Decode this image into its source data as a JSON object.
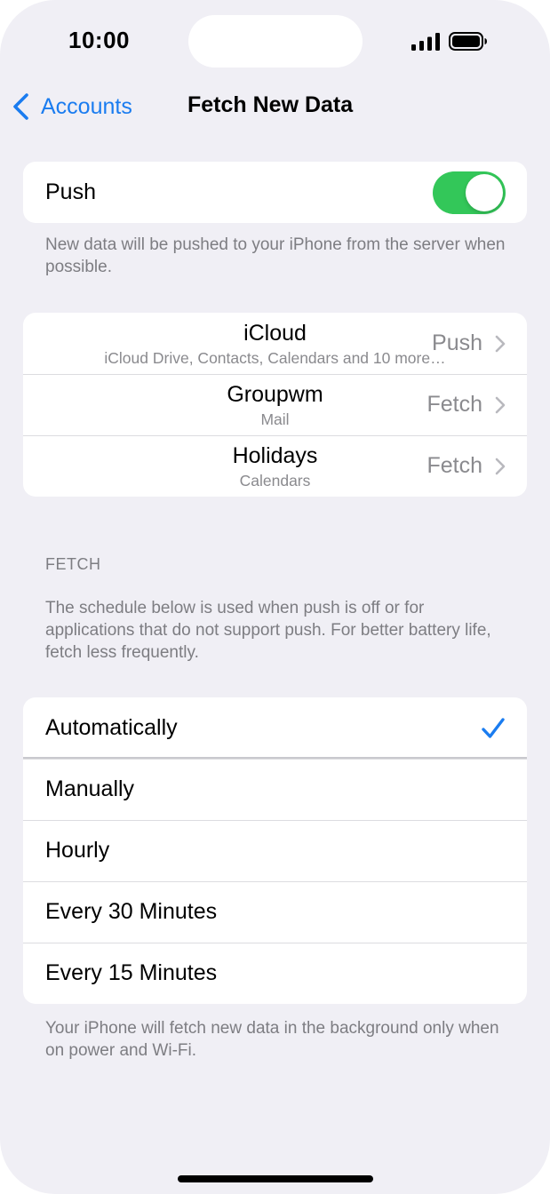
{
  "status_bar": {
    "time": "10:00"
  },
  "nav": {
    "back_label": "Accounts",
    "title": "Fetch New Data"
  },
  "push": {
    "label": "Push",
    "enabled": true,
    "footer": "New data will be pushed to your iPhone from the server when possible."
  },
  "accounts": [
    {
      "name": "iCloud",
      "detail": "iCloud Drive, Contacts, Calendars and 10 more…",
      "value": "Push"
    },
    {
      "name": "Groupwm",
      "detail": "Mail",
      "value": "Fetch"
    },
    {
      "name": "Holidays",
      "detail": "Calendars",
      "value": "Fetch"
    }
  ],
  "fetch": {
    "header": "FETCH",
    "description": "The schedule below is used when push is off or for applications that do not support push. For better battery life, fetch less frequently.",
    "options": [
      {
        "label": "Automatically",
        "selected": true
      },
      {
        "label": "Manually",
        "selected": false
      },
      {
        "label": "Hourly",
        "selected": false
      },
      {
        "label": "Every 30 Minutes",
        "selected": false
      },
      {
        "label": "Every 15 Minutes",
        "selected": false
      }
    ],
    "footer": "Your iPhone will fetch new data in the background only when on power and Wi-Fi."
  },
  "colors": {
    "accent": "#1a7cf0",
    "toggle_on": "#33c759",
    "background": "#f0eff5"
  }
}
